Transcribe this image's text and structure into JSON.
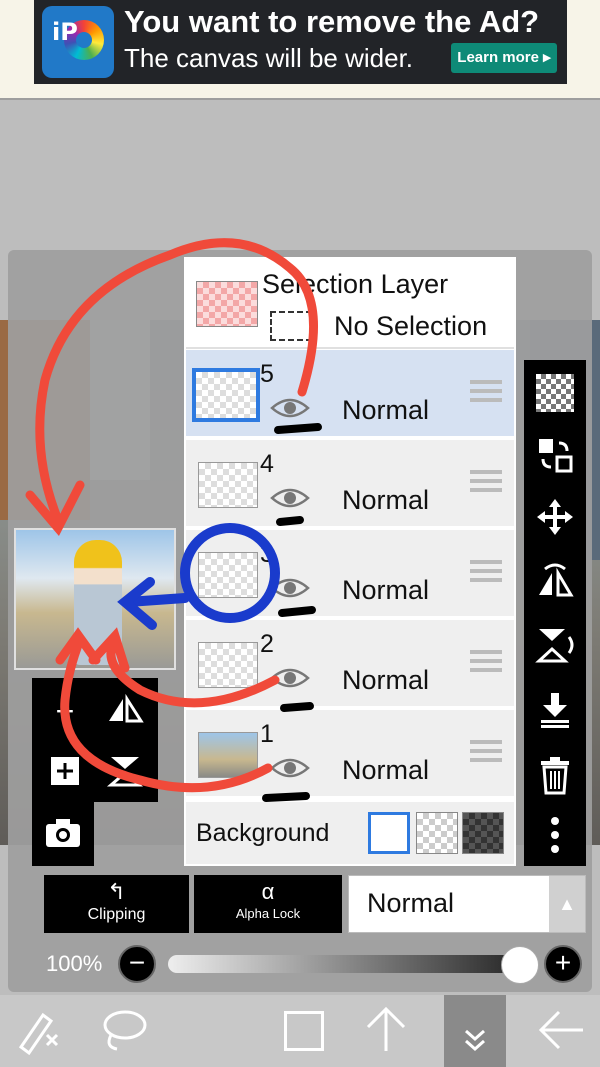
{
  "ad": {
    "logo_text": "iP",
    "title": "You want to remove the Ad?",
    "subtitle": "The canvas will be wider.",
    "cta": "Learn more ▸"
  },
  "selection_layer": {
    "title": "Selection Layer",
    "status": "No Selection"
  },
  "layers": [
    {
      "number": "5",
      "mode": "Normal",
      "selected": true
    },
    {
      "number": "4",
      "mode": "Normal",
      "selected": false
    },
    {
      "number": "3",
      "mode": "Normal",
      "selected": false
    },
    {
      "number": "2",
      "mode": "Normal",
      "selected": false
    },
    {
      "number": "1",
      "mode": "Normal",
      "selected": false
    }
  ],
  "background": {
    "label": "Background",
    "options": [
      "white",
      "transparent",
      "dark"
    ],
    "selected": "white"
  },
  "buttons": {
    "clipping": "Clipping",
    "alpha_lock": "Alpha Lock",
    "alpha_icon": "α"
  },
  "blend_mode": {
    "value": "Normal"
  },
  "opacity": {
    "label": "100%",
    "value": 100
  },
  "left_tools": [
    "add-layer",
    "flip-horizontal",
    "copy-layer",
    "flip-vertical",
    "camera"
  ],
  "right_tools": [
    "transparency",
    "transform-layer",
    "move",
    "flip-horizontal",
    "flip-vertical",
    "merge-down",
    "delete",
    "more"
  ],
  "bottom_nav": [
    "brush-tool",
    "lasso",
    "selection",
    "up-arrow",
    "collapse",
    "back"
  ],
  "colors": {
    "accent": "#2e7ae0",
    "annotation_red": "#f04a3a",
    "annotation_blue": "#1a3bcc",
    "ad_cta": "#0e8a77"
  }
}
